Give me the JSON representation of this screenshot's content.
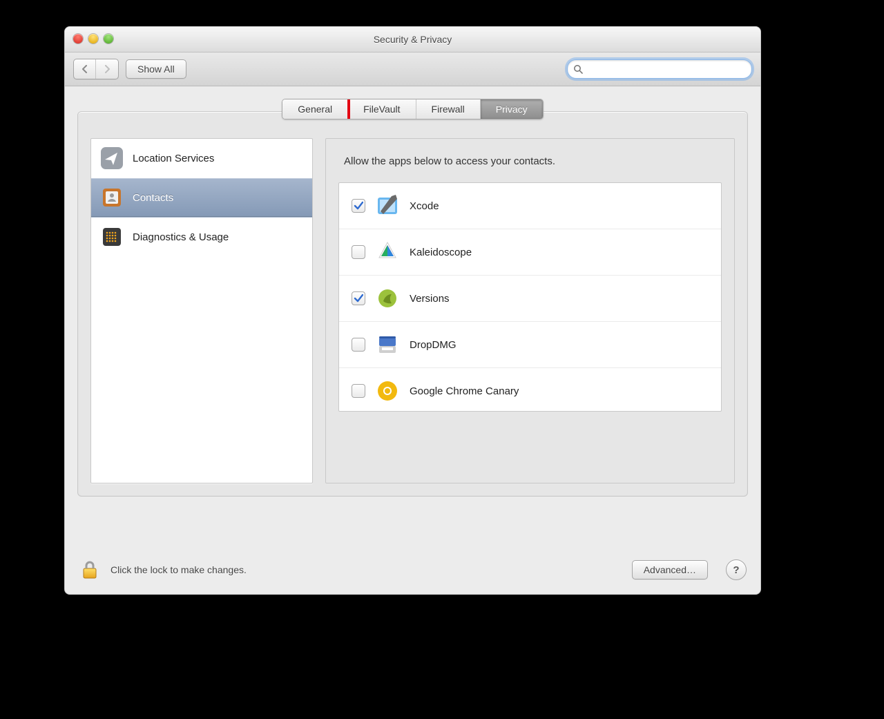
{
  "window": {
    "title": "Security & Privacy"
  },
  "toolbar": {
    "back_label": "Back",
    "forward_label": "Forward",
    "show_all_label": "Show All",
    "search_placeholder": ""
  },
  "tabs": [
    {
      "label": "General",
      "active": false,
      "highlighted": true
    },
    {
      "label": "FileVault",
      "active": false,
      "highlighted": false
    },
    {
      "label": "Firewall",
      "active": false,
      "highlighted": false
    },
    {
      "label": "Privacy",
      "active": true,
      "highlighted": false
    }
  ],
  "sidebar": {
    "items": [
      {
        "label": "Location Services",
        "icon": "location-arrow-icon",
        "selected": false
      },
      {
        "label": "Contacts",
        "icon": "address-book-icon",
        "selected": true
      },
      {
        "label": "Diagnostics & Usage",
        "icon": "diagnostics-icon",
        "selected": false
      }
    ]
  },
  "content": {
    "heading": "Allow the apps below to access your contacts.",
    "apps": [
      {
        "name": "Xcode",
        "checked": true,
        "icon": "xcode-icon"
      },
      {
        "name": "Kaleidoscope",
        "checked": false,
        "icon": "kaleidoscope-icon"
      },
      {
        "name": "Versions",
        "checked": true,
        "icon": "versions-icon"
      },
      {
        "name": "DropDMG",
        "checked": false,
        "icon": "dropdmg-icon"
      },
      {
        "name": "Google Chrome Canary",
        "checked": false,
        "icon": "chrome-canary-icon"
      }
    ]
  },
  "footer": {
    "lock_text": "Click the lock to make changes.",
    "advanced_label": "Advanced…",
    "help_label": "?"
  }
}
